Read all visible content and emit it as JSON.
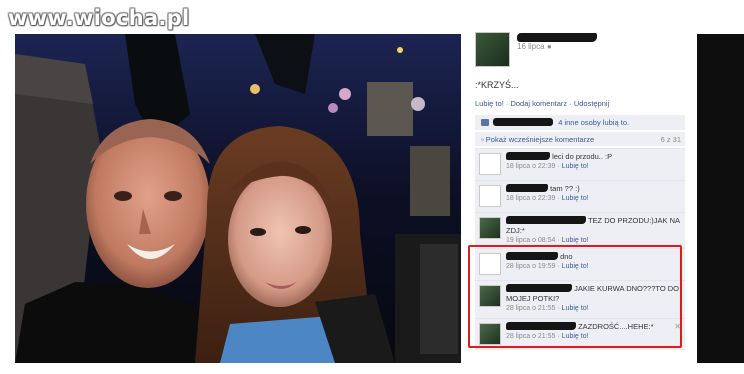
{
  "watermark": {
    "text": "www.wiocha.pl"
  },
  "post": {
    "date": "16 lipca",
    "caption": ":*KRZYŚ...",
    "actions": {
      "like": "Lubię to!",
      "comment": "Dodaj komentarz",
      "share": "Udostępnij",
      "sep": " · "
    },
    "likes_text": "4 inne osoby lubią to.",
    "prev_comments_label": "Pokaż wcześniejsze komentarze",
    "comment_count": "6 z 31"
  },
  "comments": [
    {
      "text": "leci do przodu.. :P",
      "time": "18 lipca o 22:39",
      "like": "Lubię to!",
      "avatar": "blank"
    },
    {
      "text": "tam ?? :)",
      "time": "18 lipca o 22:39",
      "like": "Lubię to!",
      "avatar": "blank"
    },
    {
      "text": "TEZ DO PRZODU:)JAK NA ZDJ:*",
      "time": "19 lipca o 08:54",
      "like": "Lubię to!",
      "avatar": "photo"
    },
    {
      "text": "dno",
      "time": "28 lipca o 19:59",
      "like": "Lubię to!",
      "avatar": "blank"
    },
    {
      "text": "JAKIE KURWA DNO???TO DO MOJEJ POTKI?",
      "time": "28 lipca o 21:55",
      "like": "Lubię to!",
      "avatar": "photo"
    },
    {
      "text": "ZAZDROŚĆ....HEHE:*",
      "time": "28 lipca o 21:55",
      "like": "Lubię to!",
      "avatar": "photo"
    }
  ],
  "icons": {
    "close": "close-icon",
    "like": "thumbs-up-icon",
    "privacy": "globe-icon"
  },
  "colors": {
    "link": "#3b5998",
    "highlight": "#e11b1b",
    "panel_bg": "#edeff4"
  }
}
